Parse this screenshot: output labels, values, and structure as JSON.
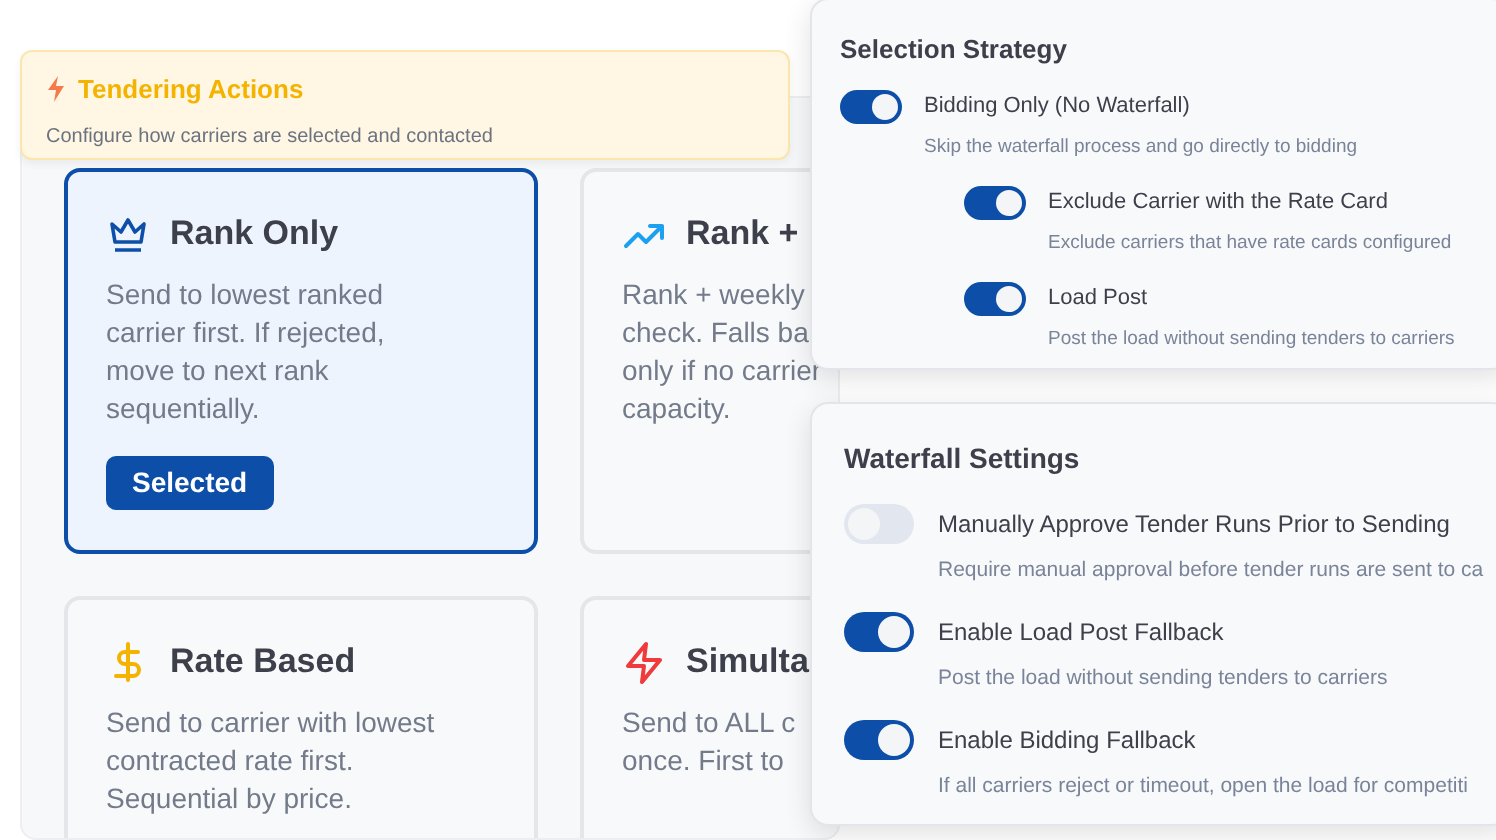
{
  "header": {
    "title": "Tendering Actions",
    "subtitle": "Configure how carriers are selected and contacted"
  },
  "strategies": [
    {
      "title": "Rank Only",
      "lines": [
        "Send to lowest ranked",
        "carrier first. If rejected,",
        "move to next rank",
        "sequentially."
      ],
      "selected": true,
      "badge": "Selected"
    },
    {
      "title": "Rank +",
      "lines": [
        "Rank + weekly",
        "check. Falls ba",
        "only if no carrier",
        "capacity."
      ],
      "selected": false
    },
    {
      "title": "Rate Based",
      "lines": [
        "Send to carrier with lowest",
        "contracted rate first.",
        "Sequential by price."
      ],
      "selected": false
    },
    {
      "title": "Simulta",
      "lines": [
        "Send to ALL c",
        "once. First to"
      ],
      "selected": false
    }
  ],
  "selection_strategy": {
    "title": "Selection Strategy",
    "options": [
      {
        "label": "Bidding Only (No Waterfall)",
        "description": "Skip the waterfall process and go directly to bidding",
        "on": true,
        "children": [
          {
            "label": "Exclude Carrier with the Rate Card",
            "description": "Exclude carriers that have rate cards configured",
            "on": true
          },
          {
            "label": "Load Post",
            "description": "Post the load without sending tenders to carriers",
            "on": true
          }
        ]
      }
    ]
  },
  "waterfall_settings": {
    "title": "Waterfall Settings",
    "options": [
      {
        "label": "Manually Approve Tender Runs Prior to Sending",
        "description": "Require manual approval before tender runs are sent to ca",
        "on": false
      },
      {
        "label": "Enable Load Post Fallback",
        "description": "Post the load without sending tenders to carriers",
        "on": true
      },
      {
        "label": "Enable Bidding Fallback",
        "description": "If all carriers reject or timeout, open the load for competiti",
        "on": true
      }
    ]
  }
}
